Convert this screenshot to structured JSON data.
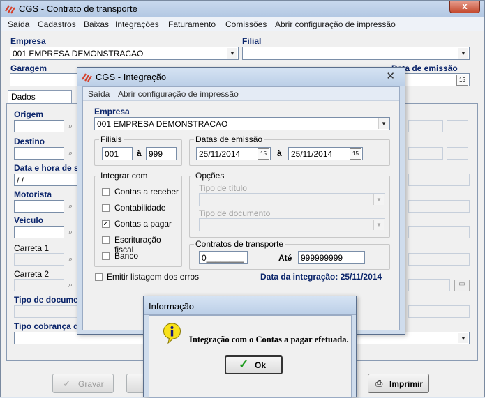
{
  "main": {
    "title": "CGS - Contrato de transporte",
    "close_label": "x",
    "menu": [
      "Saída",
      "Cadastros",
      "Baixas",
      "Integrações",
      "Faturamento",
      "Comissões",
      "Abrir configuração de impressão"
    ],
    "empresa_label": "Empresa",
    "empresa_value": "001 EMPRESA DEMONSTRACAO",
    "filial_label": "Filial",
    "filial_value": "",
    "garagem_label": "Garagem",
    "data_emissao_label": "Data de emissão",
    "tabs": [
      "Dados cadastrais"
    ],
    "origem_label": "Origem",
    "destino_label": "Destino",
    "data_hora_label": "Data e hora de s",
    "data_hora_value": " /  /",
    "motorista_label": "Motorista",
    "veiculo_label": "Veículo",
    "carreta1_label": "Carreta 1",
    "carreta2_label": "Carreta 2",
    "tipo_doc_label": "Tipo de docume",
    "tipo_cobranca_label": "Tipo cobrança d",
    "gravar_label": "Gravar",
    "imprimir_label": "Imprimir"
  },
  "integracao": {
    "title": "CGS - Integração",
    "menu": [
      "Saída",
      "Abrir configuração de impressão"
    ],
    "empresa_label": "Empresa",
    "empresa_value": "001 EMPRESA DEMONSTRACAO",
    "filiais_label": "Filiais",
    "filial_de": "001",
    "a_label": "à",
    "filial_ate": "999",
    "datas_label": "Datas de emissão",
    "data_de": "25/11/2014",
    "data_ate": "25/11/2014",
    "integrar_label": "Integrar com",
    "integrar_options": [
      {
        "label": "Contas a receber",
        "checked": false
      },
      {
        "label": "Contabilidade",
        "checked": false
      },
      {
        "label": "Contas a pagar",
        "checked": true
      },
      {
        "label": "Escrituração fiscal",
        "checked": false
      },
      {
        "label": "Banco",
        "checked": false
      }
    ],
    "opcoes_label": "Opções",
    "tipo_titulo_label": "Tipo de título",
    "tipo_documento_label": "Tipo de documento",
    "contratos_label": "Contratos de transporte",
    "contrato_de": "0________",
    "ate_label": "Até",
    "contrato_ate": "999999999",
    "emitir_label": "Emitir listagem dos erros",
    "data_integracao": "Data da integração: 25/11/2014"
  },
  "info": {
    "title": "Informação",
    "message": "Integração com o Contas a pagar efetuada.",
    "ok_label": "Ok",
    "icon": "info-icon"
  }
}
